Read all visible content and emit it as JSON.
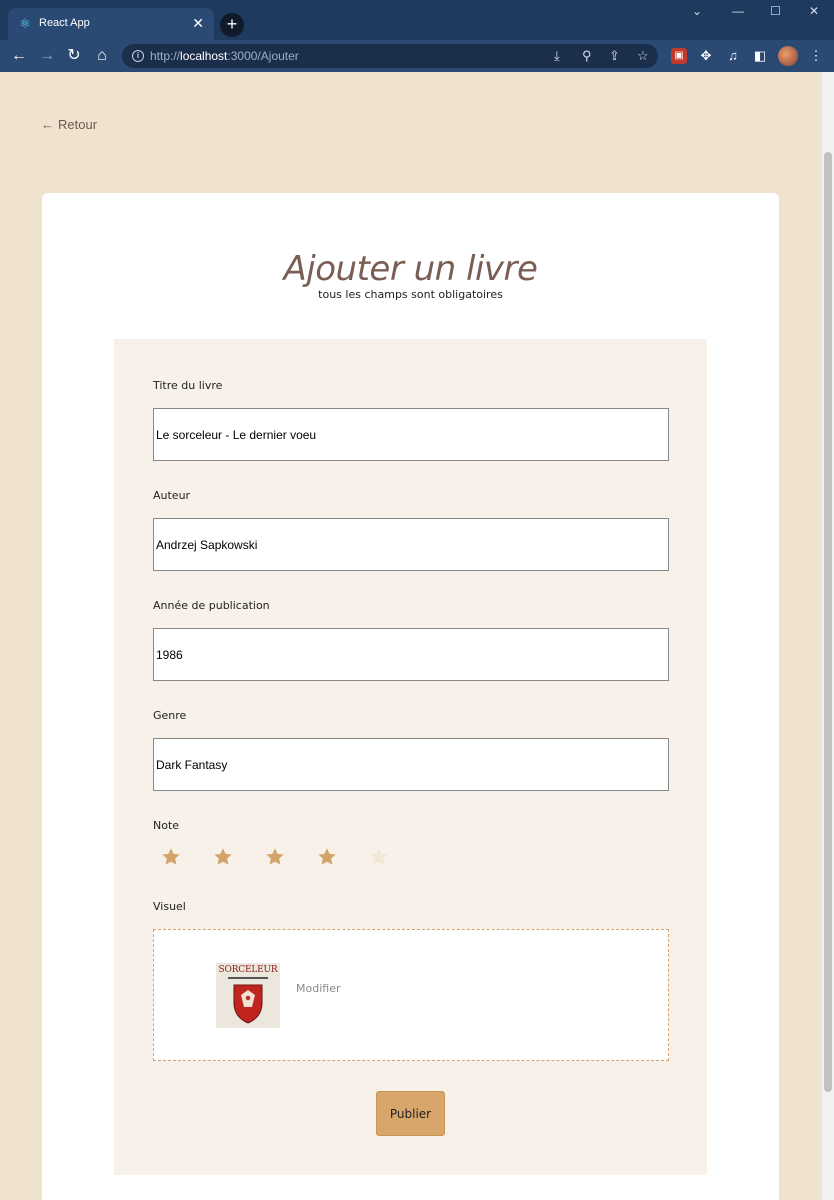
{
  "browser": {
    "tab_title": "React App",
    "tab_close": "✕",
    "new_tab": "+",
    "url_host": "localhost",
    "url_rest": ":3000/Ajouter",
    "url_scheme": "http://"
  },
  "nav": {
    "back_label": "Retour"
  },
  "form": {
    "title": "Ajouter un livre",
    "subtitle": "tous les champs sont obligatoires",
    "fields": {
      "titre": {
        "label": "Titre du livre",
        "value": "Le sorceleur - Le dernier voeu"
      },
      "auteur": {
        "label": "Auteur",
        "value": "Andrzej Sapkowski"
      },
      "annee": {
        "label": "Année de publication",
        "value": "1986"
      },
      "genre": {
        "label": "Genre",
        "value": "Dark Fantasy"
      }
    },
    "note": {
      "label": "Note",
      "rating": 4,
      "max": 5,
      "filled_color": "#d4a36a",
      "empty_color": "#f2e6d4"
    },
    "visuel": {
      "label": "Visuel",
      "cover_title": "SORCELEUR",
      "modify_label": "Modifier"
    },
    "publish_label": "Publier"
  },
  "colors": {
    "page_bg": "#efe3d0",
    "panel_bg": "#f7f1ea",
    "accent": "#d8a56a",
    "title": "#7a5e55"
  }
}
